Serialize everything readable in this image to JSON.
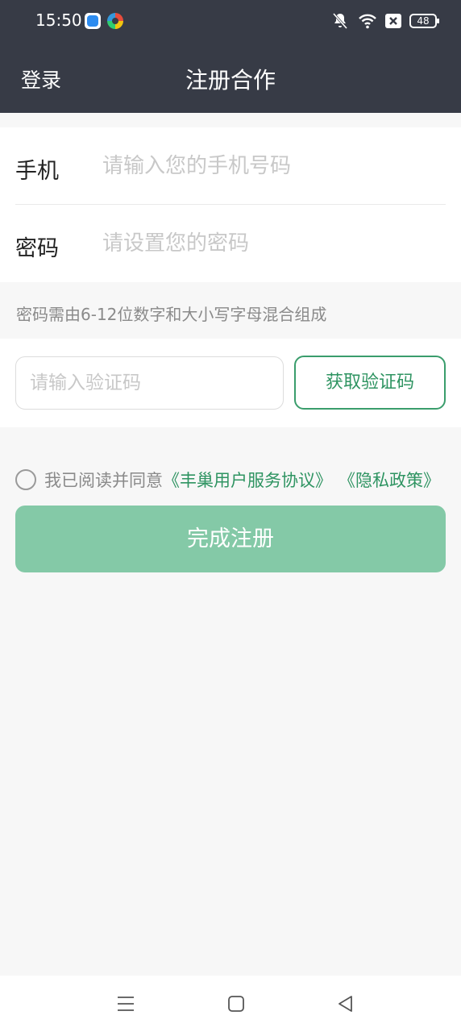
{
  "status_bar": {
    "time": "15:50",
    "battery": "48",
    "icons": [
      "app-notification-blue-icon",
      "app-notification-colorful-icon",
      "mute-icon",
      "wifi-icon",
      "sim-blocked-icon",
      "battery-icon"
    ]
  },
  "nav": {
    "back_label": "登录",
    "title": "注册合作"
  },
  "form": {
    "phone_label": "手机",
    "phone_placeholder": "请输入您的手机号码",
    "password_label": "密码",
    "password_placeholder": "请设置您的密码"
  },
  "hint": "密码需由6-12位数字和大小写字母混合组成",
  "verification": {
    "placeholder": "请输入验证码",
    "button_label": "获取验证码"
  },
  "agreement": {
    "text": "我已阅读并同意",
    "terms_link": "《丰巢用户服务协议》",
    "privacy_link": "《隐私政策》",
    "checked": false
  },
  "submit_label": "完成注册",
  "colors": {
    "header_bg": "#373b46",
    "accent_green": "#2f9462",
    "submit_bg": "#84c9a7",
    "page_bg": "#f7f7f7"
  },
  "system_nav": {
    "icons": [
      "menu-icon",
      "home-icon",
      "back-icon"
    ]
  }
}
